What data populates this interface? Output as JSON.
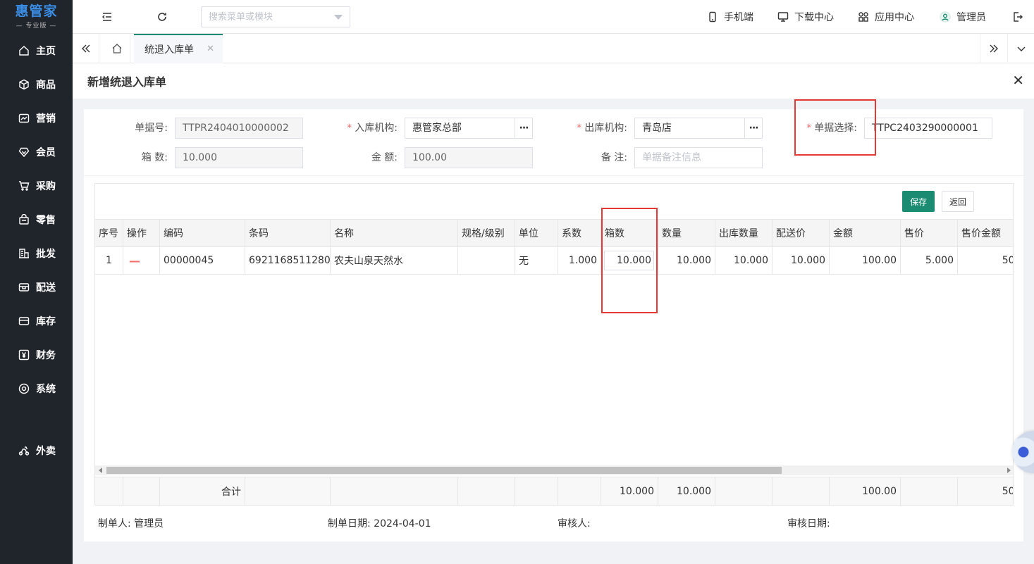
{
  "sidebar": {
    "logo_title": "惠管家",
    "logo_sub": "— 专业版 —",
    "items": [
      {
        "label": "主页",
        "icon": "home-icon"
      },
      {
        "label": "商品",
        "icon": "cube-icon"
      },
      {
        "label": "营销",
        "icon": "chart-icon"
      },
      {
        "label": "会员",
        "icon": "diamond-icon"
      },
      {
        "label": "采购",
        "icon": "cart-icon"
      },
      {
        "label": "零售",
        "icon": "bag-icon"
      },
      {
        "label": "批发",
        "icon": "building-icon"
      },
      {
        "label": "配送",
        "icon": "truck-icon"
      },
      {
        "label": "库存",
        "icon": "box-icon"
      },
      {
        "label": "财务",
        "icon": "yen-icon"
      },
      {
        "label": "系统",
        "icon": "settings-icon"
      },
      {
        "label": "外卖",
        "icon": "scooter-icon"
      }
    ]
  },
  "header": {
    "search_placeholder": "搜索菜单或模块",
    "mobile": "手机端",
    "download": "下载中心",
    "apps": "应用中心",
    "user": "管理员"
  },
  "tabs": {
    "active": "统退入库单"
  },
  "page": {
    "title": "新增统退入库单"
  },
  "form": {
    "doc_no_label": "单据号:",
    "doc_no": "TTPR2404010000002",
    "in_org_label": "入库机构:",
    "in_org": "惠管家总部",
    "out_org_label": "出库机构:",
    "out_org": "青岛店",
    "doc_select_label": "单据选择:",
    "doc_select": "TTPC2403290000001",
    "boxes_label": "箱 数:",
    "boxes": "10.000",
    "amount_label": "金 额:",
    "amount": "100.00",
    "remark_label": "备 注:",
    "remark_placeholder": "单据备注信息",
    "dots": "···"
  },
  "toolbar": {
    "save": "保存",
    "back": "返回"
  },
  "table": {
    "columns": [
      "序号",
      "操作",
      "编码",
      "条码",
      "名称",
      "规格/级别",
      "单位",
      "系数",
      "箱数",
      "数量",
      "出库数量",
      "配送价",
      "金额",
      "售价",
      "售价金额"
    ],
    "rows": [
      {
        "seq": "1",
        "op": "—",
        "code": "00000045",
        "barcode": "6921168511280",
        "name": "农夫山泉天然水",
        "spec": "",
        "unit": "无",
        "factor": "1.000",
        "boxes": "10.000",
        "qty": "10.000",
        "out_qty": "10.000",
        "price": "10.000",
        "amount": "100.00",
        "sale_price": "5.000",
        "sale_amount": "50."
      }
    ],
    "footer": {
      "label": "合计",
      "boxes": "10.000",
      "qty": "10.000",
      "amount": "100.00",
      "sale_amount": "50."
    }
  },
  "signoff": {
    "maker_label": "制单人:",
    "maker": "管理员",
    "date_label": "制单日期:",
    "date": "2024-04-01",
    "auditor_label": "审核人:",
    "auditor": "",
    "audit_date_label": "审核日期:",
    "audit_date": ""
  },
  "colors": {
    "accent": "#1b8c72",
    "sidebar_bg": "#20242b",
    "logo": "#3a8ee6",
    "required": "#f56c6c",
    "highlight": "#e53935"
  }
}
